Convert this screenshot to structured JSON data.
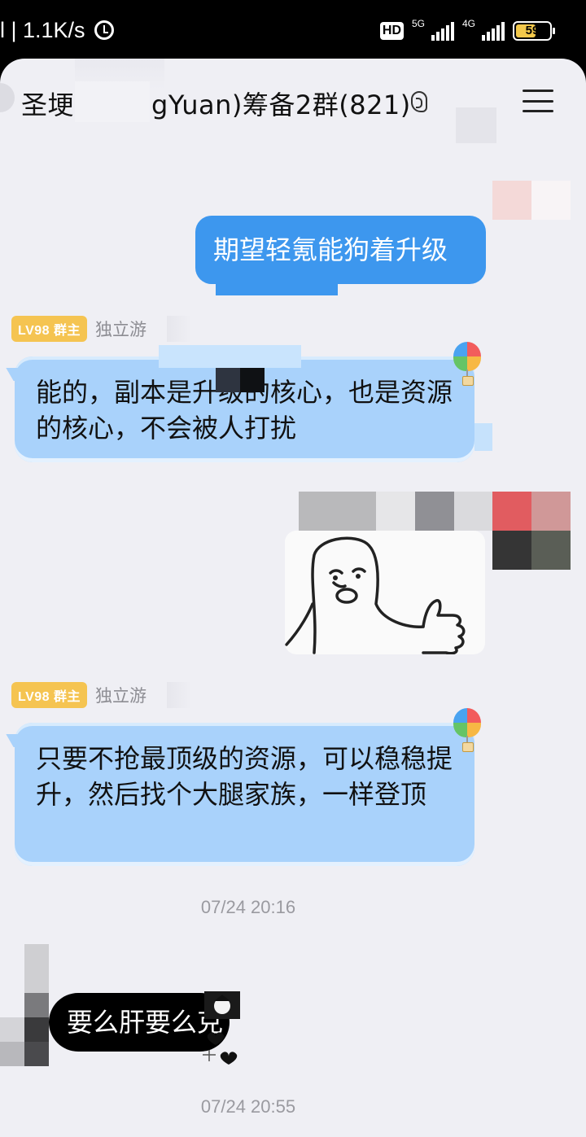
{
  "status_bar": {
    "left_text": "l | 1.1K/s",
    "hd_label": "HD",
    "signal_1_label": "5G",
    "signal_2_label": "4G",
    "battery_level": "59"
  },
  "chat": {
    "title_prefix": "圣埂",
    "title_suffix": "gYuan)筹备2群(821)"
  },
  "messages": {
    "outgoing_1": "期望轻氪能狗着升级",
    "sender_1": {
      "level_badge": "LV98 群主",
      "name": "独立游"
    },
    "incoming_1": "能的，副本是升级的核心，也是资源的核心，不会被人打扰",
    "sender_2": {
      "level_badge": "LV98 群主",
      "name": "独立游"
    },
    "incoming_2": "只要不抢最顶级的资源，可以稳稳提升，然后找个大腿家族，一样登顶",
    "timestamp_1": "07/24 20:16",
    "incoming_3": "要么肝要么克",
    "timestamp_2": "07/24 20:55"
  }
}
